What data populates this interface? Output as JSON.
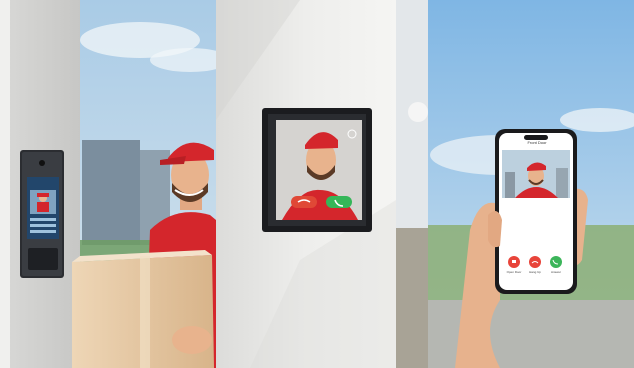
{
  "panels": [
    {
      "id": "outdoor-intercom",
      "scene": "delivery-person-at-outdoor-intercom-panel"
    },
    {
      "id": "indoor-monitor",
      "scene": "wall-mounted-indoor-video-monitor"
    },
    {
      "id": "smartphone-app",
      "scene": "hand-holding-smartphone-video-call"
    }
  ],
  "phone_screen": {
    "title": "Front Door",
    "buttons": [
      {
        "label": "Open Door",
        "icon": "unlock-icon",
        "color": "#e8443a"
      },
      {
        "label": "Hang Up",
        "icon": "hangup-icon",
        "color": "#e8443a"
      },
      {
        "label": "Answer",
        "icon": "phone-icon",
        "color": "#3cb55a"
      }
    ]
  },
  "monitor_screen": {
    "buttons": [
      {
        "icon": "hangup-icon",
        "color": "#e04836"
      },
      {
        "icon": "phone-icon",
        "color": "#35b658"
      }
    ]
  },
  "colors": {
    "sky": "#9dc4e2",
    "wall": "#e9e9e7",
    "uniform_red": "#d4262c",
    "box": "#e6c9a4"
  }
}
